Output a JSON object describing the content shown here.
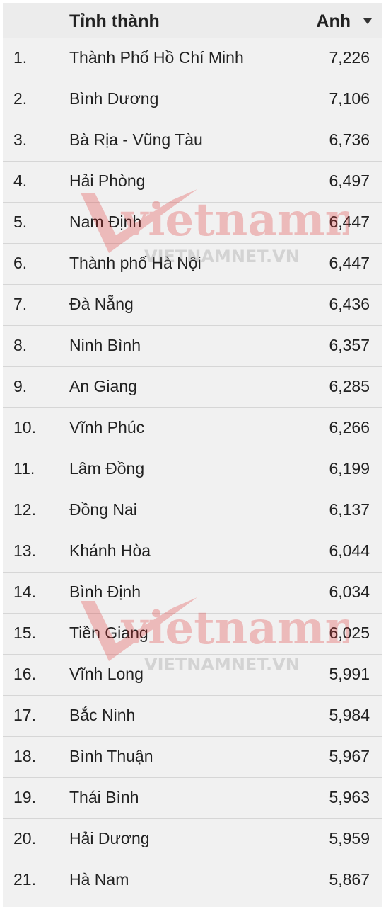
{
  "header": {
    "province_label": "Tỉnh thành",
    "score_label": "Anh"
  },
  "watermark": {
    "brand": "vietnamnet",
    "url": "VIETNAMNET.VN"
  },
  "rows": [
    {
      "rank": "1.",
      "name": "Thành Phố Hồ Chí Minh",
      "score": "7,226"
    },
    {
      "rank": "2.",
      "name": "Bình Dương",
      "score": "7,106"
    },
    {
      "rank": "3.",
      "name": "Bà Rịa - Vũng Tàu",
      "score": "6,736"
    },
    {
      "rank": "4.",
      "name": "Hải Phòng",
      "score": "6,497"
    },
    {
      "rank": "5.",
      "name": "Nam Định",
      "score": "6,447"
    },
    {
      "rank": "6.",
      "name": "Thành phố Hà Nội",
      "score": "6,447"
    },
    {
      "rank": "7.",
      "name": "Đà Nẵng",
      "score": "6,436"
    },
    {
      "rank": "8.",
      "name": "Ninh Bình",
      "score": "6,357"
    },
    {
      "rank": "9.",
      "name": "An Giang",
      "score": "6,285"
    },
    {
      "rank": "10.",
      "name": "Vĩnh Phúc",
      "score": "6,266"
    },
    {
      "rank": "11.",
      "name": "Lâm Đồng",
      "score": "6,199"
    },
    {
      "rank": "12.",
      "name": "Đồng Nai",
      "score": "6,137"
    },
    {
      "rank": "13.",
      "name": "Khánh Hòa",
      "score": "6,044"
    },
    {
      "rank": "14.",
      "name": "Bình Định",
      "score": "6,034"
    },
    {
      "rank": "15.",
      "name": "Tiền Giang",
      "score": "6,025"
    },
    {
      "rank": "16.",
      "name": "Vĩnh Long",
      "score": "5,991"
    },
    {
      "rank": "17.",
      "name": "Bắc Ninh",
      "score": "5,984"
    },
    {
      "rank": "18.",
      "name": "Bình Thuận",
      "score": "5,967"
    },
    {
      "rank": "19.",
      "name": "Thái Bình",
      "score": "5,963"
    },
    {
      "rank": "20.",
      "name": "Hải Dương",
      "score": "5,959"
    },
    {
      "rank": "21.",
      "name": "Hà Nam",
      "score": "5,867"
    }
  ]
}
